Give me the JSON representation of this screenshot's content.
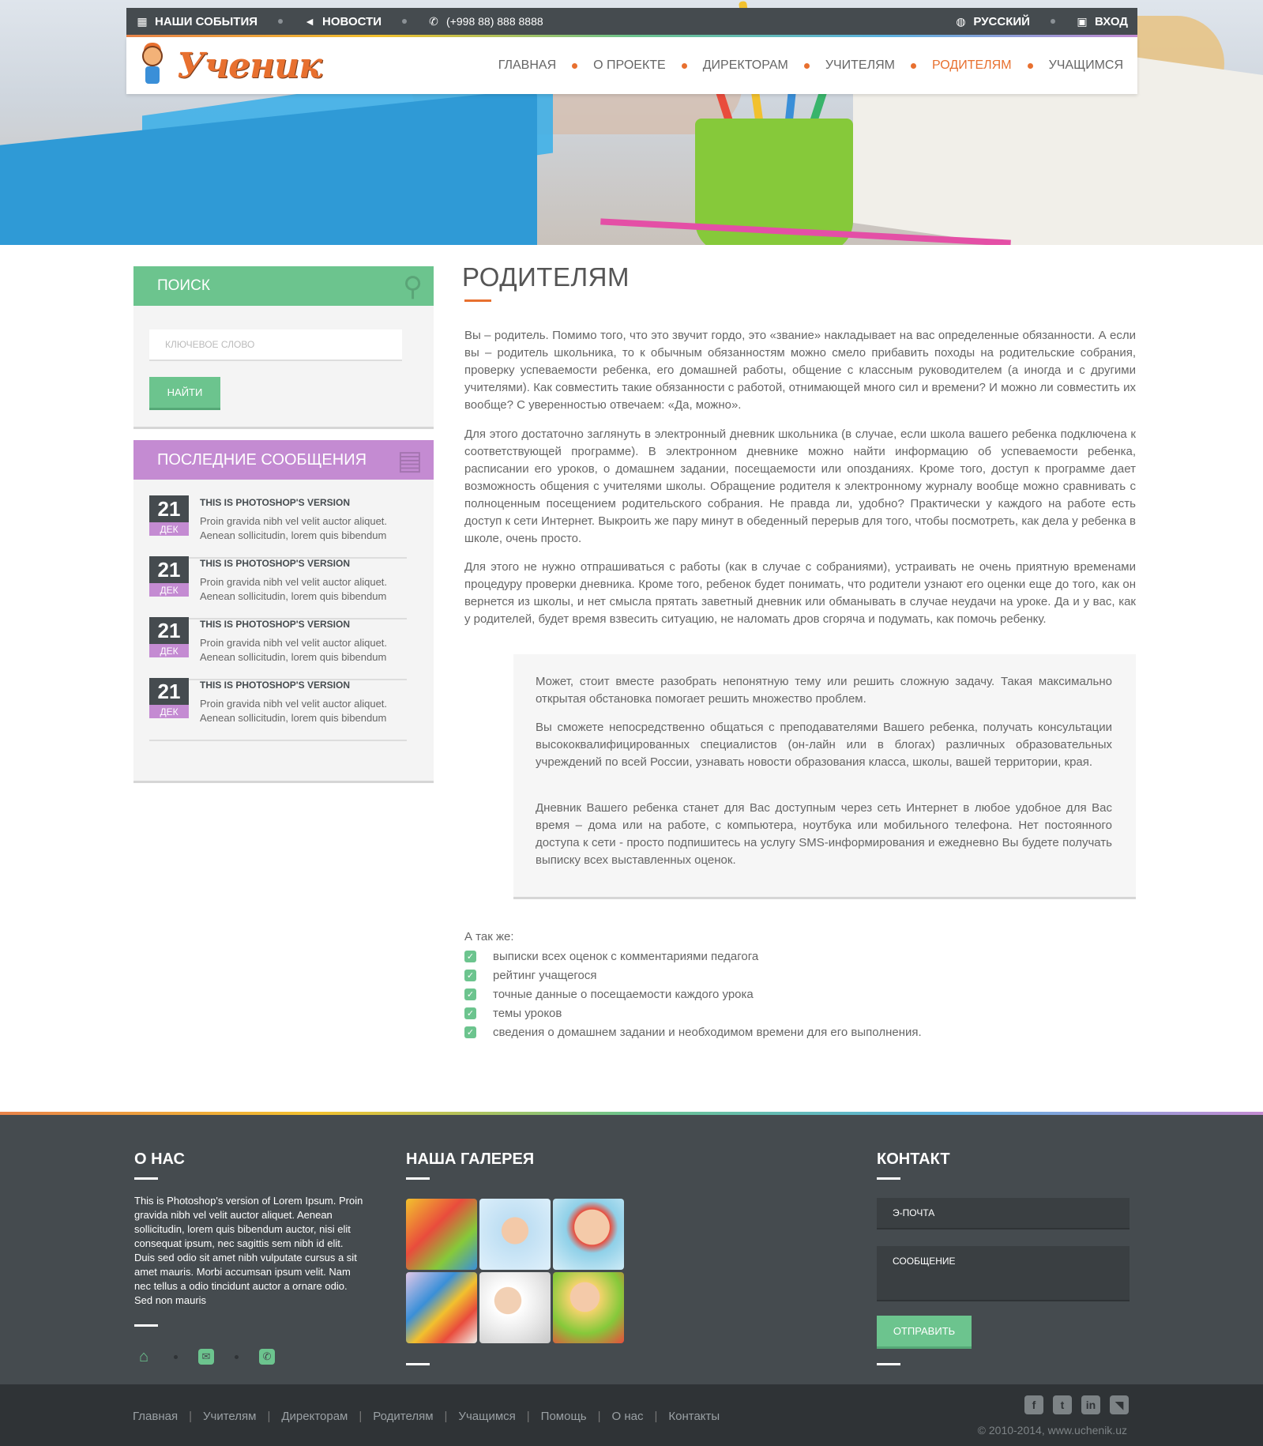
{
  "topbar": {
    "events": "НАШИ СОБЫТИЯ",
    "news": "НОВОСТИ",
    "phone": "(+998 88) 888 8888",
    "language": "РУССКИЙ",
    "login": "ВХОД"
  },
  "header": {
    "logo_text": "Ученик",
    "nav": [
      "ГЛАВНАЯ",
      "О ПРОЕКТЕ",
      "ДИРЕКТОРАМ",
      "УЧИТЕЛЯМ",
      "РОДИТЕЛЯМ",
      "УЧАЩИМСЯ"
    ],
    "active": "РОДИТЕЛЯМ"
  },
  "sidebar": {
    "search": {
      "title": "ПОИСК",
      "placeholder": "КЛЮЧЕВОЕ СЛОВО",
      "button": "НАЙТИ"
    },
    "recent": {
      "title": "ПОСЛЕДНИЕ СООБЩЕНИЯ",
      "items": [
        {
          "day": "21",
          "month": "ДЕК",
          "title": "THIS IS PHOTOSHOP'S VERSION",
          "text": "Proin gravida nibh vel velit auctor aliquet. Aenean sollicitudin, lorem quis bibendum"
        },
        {
          "day": "21",
          "month": "ДЕК",
          "title": "THIS IS PHOTOSHOP'S VERSION",
          "text": "Proin gravida nibh vel velit auctor aliquet. Aenean sollicitudin, lorem quis bibendum"
        },
        {
          "day": "21",
          "month": "ДЕК",
          "title": "THIS IS PHOTOSHOP'S VERSION",
          "text": "Proin gravida nibh vel velit auctor aliquet. Aenean sollicitudin, lorem quis bibendum"
        },
        {
          "day": "21",
          "month": "ДЕК",
          "title": "THIS IS PHOTOSHOP'S VERSION",
          "text": "Proin gravida nibh vel velit auctor aliquet. Aenean sollicitudin, lorem quis bibendum"
        }
      ]
    }
  },
  "main": {
    "title": "РОДИТЕЛЯМ",
    "paragraphs": [
      "Вы – родитель. Помимо того, что это звучит гордо, это «звание» накладывает на вас определенные обязанности. А если вы – родитель школьника, то к обычным обязанностям можно смело прибавить походы на родительские собрания, проверку успеваемости ребенка, его домашней работы, общение с классным руководителем (а иногда и с другими учителями). Как совместить такие обязанности с работой, отнимающей много сил и времени? И можно ли совместить их вообще? С уверенностью отвечаем: «Да, можно».",
      "Для этого достаточно заглянуть в электронный дневник школьника (в случае, если школа вашего ребенка подключена к соответствующей программе). В электронном дневнике можно найти информацию об успеваемости ребенка, расписании его уроков, о домашнем задании, посещаемости или опозданиях. Кроме того, доступ к программе дает возможность общения с учителями школы. Обращение родителя к электронному журналу вообще можно сравнивать с полноценным посещением родительского собрания. Не правда ли, удобно? Практически у каждого на работе есть доступ к сети Интернет. Выкроить же пару минут в обеденный перерыв для того, чтобы посмотреть, как дела у ребенка в школе, очень просто.",
      "Для этого не нужно отпрашиваться с работы (как в случае с собраниями), устраивать не очень приятную временами процедуру проверки дневника. Кроме того, ребенок будет понимать, что родители узнают его оценки еще до того, как он вернется из школы, и нет смысла прятать заветный дневник или обманывать в случае неудачи на уроке. Да и у вас, как у родителей, будет время взвесить ситуацию, не наломать дров сгоряча и подумать, как помочь ребенку."
    ],
    "quote": [
      "Может, стоит вместе разобрать непонятную тему или решить сложную задачу. Такая максимально открытая обстановка помогает решить множество проблем.",
      "Вы сможете непосредственно общаться с преподавателями Вашего ребенка, получать консультации высококвалифицированных специалистов (он-лайн или в блогах) различных образовательных учреждений по всей России, узнавать новости образования класса, школы, вашей территории, края.",
      "Дневник Вашего ребенка станет для Вас доступным через сеть Интернет в любое удобное для Вас время – дома или на работе, с компьютера, ноутбука или мобильного телефона. Нет постоянного доступа к сети - просто подпишитесь на услугу SMS-информирования и ежедневно Вы будете получать выписку всех выставленных оценок."
    ],
    "also_label": "А так же:",
    "features": [
      "выписки всех оценок с комментариями педагога",
      "рейтинг учащегося",
      "точные данные о посещаемости каждого урока",
      "темы уроков",
      "сведения о домашнем задании и необходимом времени для его выполнения."
    ]
  },
  "footer": {
    "about_title": "О НАС",
    "about_text": "This is Photoshop's version  of Lorem Ipsum. Proin gravida nibh vel velit auctor aliquet. Aenean sollicitudin, lorem quis bibendum auctor, nisi elit consequat ipsum, nec sagittis sem nibh id elit. Duis sed odio sit amet nibh vulputate cursus a sit amet mauris. Morbi accumsan ipsum velit. Nam nec tellus a odio tincidunt auctor a ornare odio. Sed non  mauris",
    "gallery_title": "НАША ГАЛЕРЕЯ",
    "contact_title": "КОНТАКТ",
    "email_placeholder": "Э-ПОЧТА",
    "message_placeholder": "СООБЩЕНИЕ",
    "send": "ОТПРАВИТЬ",
    "bottom_nav": [
      "Главная",
      "Учителям",
      "Директорам",
      "Родителям",
      "Учащимся",
      "Помощь",
      "О нас",
      "Контакты"
    ],
    "copyright": "© 2010-2014, www.uchenik.uz"
  },
  "icons": {
    "events": "calendar-icon",
    "news": "megaphone-icon",
    "phone": "phone-icon",
    "language": "globe-icon",
    "login": "lock-icon",
    "search": "search-icon",
    "recent": "document-icon",
    "feature": "check-icon",
    "social": [
      "home-icon",
      "mail-icon",
      "phone-icon"
    ],
    "bottom_social": [
      "facebook-icon",
      "twitter-icon",
      "linkedin-icon",
      "rss-icon"
    ]
  },
  "colors": {
    "green": "#6cc48e",
    "purple": "#c48bd2",
    "orange": "#e8702f",
    "dark": "#454b4f"
  }
}
